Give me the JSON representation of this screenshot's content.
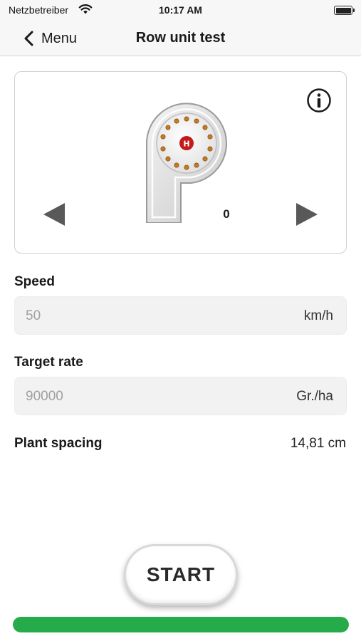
{
  "status_bar": {
    "carrier": "Netzbetreiber",
    "time": "10:17 AM"
  },
  "nav": {
    "back_label": "Menu",
    "title": "Row unit test"
  },
  "device": {
    "unit_value": "0",
    "icons": [
      "info-icon",
      "arrow-left-icon",
      "arrow-right-icon"
    ]
  },
  "speed": {
    "label": "Speed",
    "value": "50",
    "unit": "km/h"
  },
  "target_rate": {
    "label": "Target rate",
    "value": "90000",
    "unit": "Gr./ha"
  },
  "plant_spacing": {
    "label": "Plant spacing",
    "value": "14,81 cm"
  },
  "start_button": {
    "label": "START"
  },
  "progress": {
    "fraction": 1.0,
    "color": "#26ab4a"
  }
}
